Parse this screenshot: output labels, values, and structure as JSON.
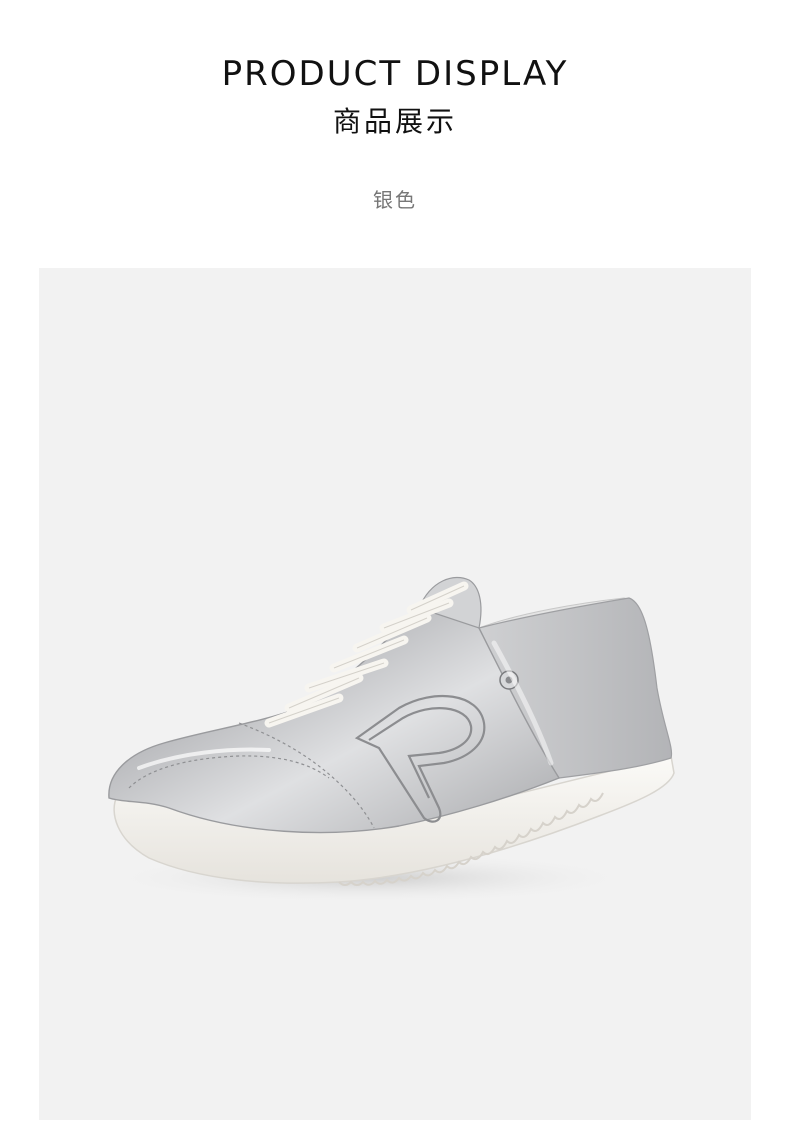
{
  "header": {
    "title_en": "PRODUCT DISPLAY",
    "title_cn": "商品展示"
  },
  "variant": {
    "color_label": "银色"
  },
  "product_image": {
    "subject": "shoe",
    "colors": {
      "panel_background": "#f2f2f2",
      "upper_silver": "#c9cacc",
      "sole_white": "#f4f2ee",
      "lace_white": "#f7f5f0"
    }
  }
}
